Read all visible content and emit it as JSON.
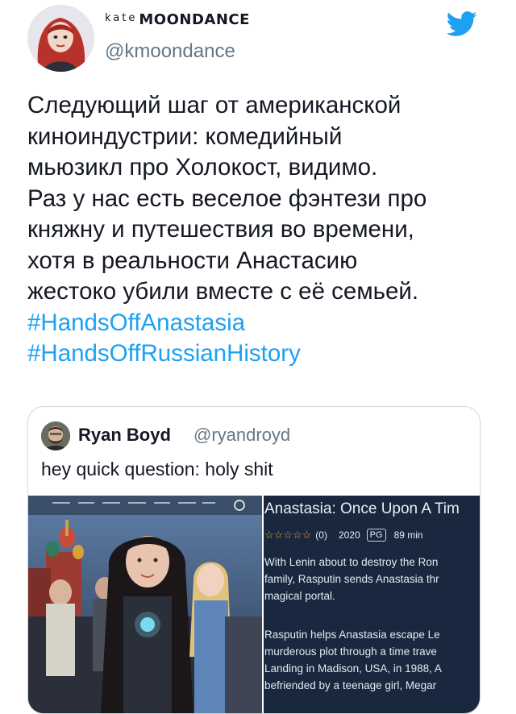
{
  "user": {
    "name_small": "kate",
    "name_main": "MOONDANCE",
    "handle": "@kmoondance"
  },
  "tweet": {
    "lines": [
      "Следующий шаг от американской",
      "киноиндустрии: комедийный",
      "мьюзикл про Холокост, видимо.",
      "Раз у нас есть веселое фэнтези про",
      "княжну и путешествия во времени,",
      "хотя в реальности Анастасию",
      "жестоко убили вместе с её семьей."
    ],
    "hashtags": [
      "#HandsOffAnastasia",
      "#HandsOffRussianHistory"
    ]
  },
  "quoted": {
    "name": "Ryan Boyd",
    "handle": "@ryandroyd",
    "text": "hey quick question: holy shit"
  },
  "movie_card": {
    "title": "Anastasia: Once Upon A Tim",
    "stars": "☆☆☆☆☆",
    "rating_count": "(0)",
    "year": "2020",
    "rating_badge": "PG",
    "runtime": "89 min",
    "description_1": [
      "With Lenin about to destroy the Ron",
      "family, Rasputin sends Anastasia thr",
      "magical portal."
    ],
    "description_2": [
      "Rasputin helps Anastasia escape Le",
      "murderous plot through a time trave",
      "Landing in Madison, USA, in 1988, A",
      "befriended by a teenage girl, Megar"
    ]
  },
  "colors": {
    "twitter_blue": "#1da1f2",
    "card_bg": "#19283e",
    "star_color": "#f2b01e"
  },
  "icons": {
    "bird": "twitter-bird-icon"
  }
}
